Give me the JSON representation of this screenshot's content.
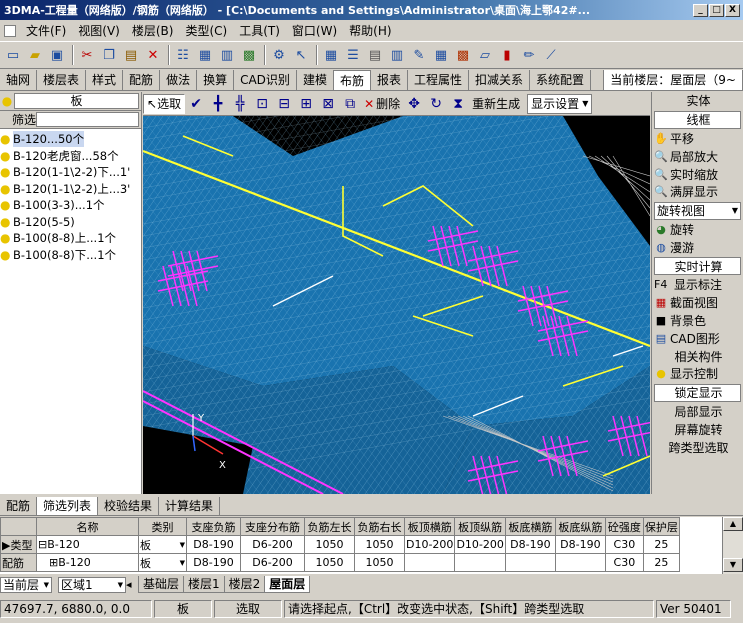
{
  "app": {
    "title": "3DMA-工程量（网络版）/钢筋（网络版） - [C:\\Documents and Settings\\Administrator\\桌面\\海上鄂42#..."
  },
  "window_buttons": {
    "minimize": "_",
    "maximize": "□",
    "close": "X"
  },
  "menu": [
    "文件(F)",
    "视图(V)",
    "楼层(B)",
    "类型(C)",
    "工具(T)",
    "窗口(W)",
    "帮助(H)"
  ],
  "main_tabs": [
    "轴网",
    "楼层表",
    "样式",
    "配筋",
    "做法",
    "换算",
    "CAD识别",
    "建模",
    "布筋",
    "报表",
    "工程属性",
    "扣减关系",
    "系统配置"
  ],
  "active_tab": "布筋",
  "current_floor": "当前楼层：屋面层（9~",
  "left_panel": {
    "type_combo": "板",
    "filter_label": "筛选",
    "items": [
      "B-120...50个",
      "B-120老虎窗...58个",
      "B-120(1-1\\2-2)下...1'",
      "B-120(1-1\\2-2)上...3'",
      "B-100(3-3)...1个",
      "B-120(5-5)",
      "B-100(8-8)上...1个",
      "B-100(8-8)下...1个"
    ]
  },
  "command_bar": {
    "select": "选取",
    "delete": "删除",
    "regenerate": "重新生成",
    "display_settings": "显示设置"
  },
  "right_panel": {
    "solid": "实体",
    "wireframe": "线框",
    "pan": "平移",
    "zoom_local": "局部放大",
    "zoom_realtime": "实时缩放",
    "fit_screen": "满屏显示",
    "rotate_view": "旋转视图",
    "rotate": "旋转",
    "roam": "漫游",
    "realtime_calc": "实时计算",
    "show_mark_key": "F4",
    "show_mark": "显示标注",
    "section_view": "截面视图",
    "bg_color": "背景色",
    "cad_graphics": "CAD图形",
    "related": "相关构件",
    "display_control": "显示控制",
    "lock_display": "锁定显示",
    "local_display": "局部显示",
    "screen_rotate": "屏幕旋转",
    "cross_type": "跨类型选取"
  },
  "axis_labels": {
    "x": "X",
    "y": "Y"
  },
  "bottom_tabs": [
    "配筋",
    "筛选列表",
    "校验结果",
    "计算结果"
  ],
  "bottom_active": "筛选列表",
  "grid": {
    "headers": [
      "名称",
      "类别",
      "支座负筋",
      "支座分布筋",
      "负筋左长",
      "负筋右长",
      "板顶横筋",
      "板顶纵筋",
      "板底横筋",
      "板底纵筋",
      "砼强度",
      "保护层"
    ],
    "rows": [
      {
        "lead": "类型",
        "name": "B-120",
        "cat": "板",
        "cells": [
          "D8-190",
          "D6-200",
          "1050",
          "1050",
          "D10-200",
          "D10-200",
          "D8-190",
          "D8-190",
          "C30",
          "25"
        ]
      },
      {
        "lead": "配筋",
        "name": "B-120",
        "cat": "板",
        "cells": [
          "D8-190",
          "D6-200",
          "1050",
          "1050",
          "",
          "",
          "",
          "",
          "C30",
          "25"
        ]
      }
    ]
  },
  "layer_bar": {
    "current": "当前层",
    "region": "区域1",
    "floors": [
      "基础层",
      "楼层1",
      "楼层2",
      "屋面层"
    ]
  },
  "status": {
    "coords": "47697.7, 6880.0, 0.0",
    "type": "板",
    "mode": "选取",
    "hint": "请选择起点,【Ctrl】改变选中状态,【Shift】跨类型选取",
    "version": "Ver 50401"
  }
}
